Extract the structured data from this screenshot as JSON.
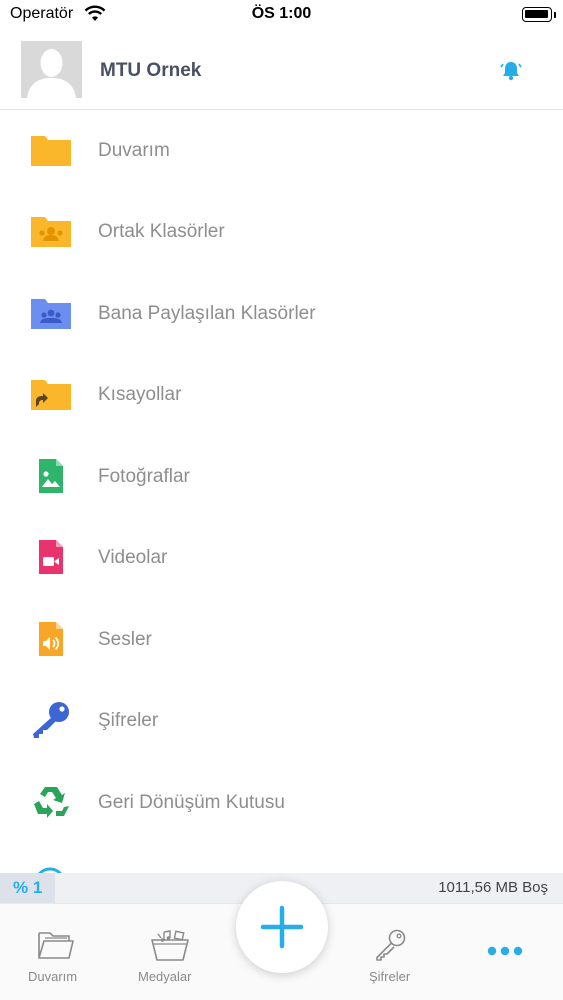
{
  "status_bar": {
    "carrier": "Operatör",
    "time": "ÖS 1:00"
  },
  "header": {
    "user_name": "MTU Ornek"
  },
  "menu": {
    "items": [
      {
        "label": "Duvarım",
        "icon": "folder-icon"
      },
      {
        "label": "Ortak Klasörler",
        "icon": "shared-folder-icon"
      },
      {
        "label": "Bana Paylaşılan Klasörler",
        "icon": "shared-with-me-folder-icon"
      },
      {
        "label": "Kısayollar",
        "icon": "shortcut-folder-icon"
      },
      {
        "label": "Fotoğraflar",
        "icon": "photo-file-icon"
      },
      {
        "label": "Videolar",
        "icon": "video-file-icon"
      },
      {
        "label": "Sesler",
        "icon": "audio-file-icon"
      },
      {
        "label": "Şifreler",
        "icon": "key-icon"
      },
      {
        "label": "Geri Dönüşüm Kutusu",
        "icon": "recycle-icon"
      }
    ]
  },
  "storage": {
    "percent_label": "% 1",
    "used_fraction": 0.01,
    "free_label": "1011,56 MB Boş"
  },
  "tabbar": {
    "tabs": [
      {
        "label": "Duvarım",
        "icon": "folder-outline-icon"
      },
      {
        "label": "Medyalar",
        "icon": "media-icon"
      },
      {
        "label": "",
        "icon": "plus-icon"
      },
      {
        "label": "Şifreler",
        "icon": "key-outline-icon"
      },
      {
        "label": "",
        "icon": "more-icon"
      }
    ]
  },
  "colors": {
    "accent": "#27aee6",
    "folder_yellow": "#fbb72c",
    "folder_blue": "#6b8ef0",
    "photo_green": "#2fb56b",
    "video_pink": "#e8336d",
    "audio_orange": "#f7a627",
    "key_blue": "#3d65d6",
    "recycle_green": "#2aa45a"
  }
}
